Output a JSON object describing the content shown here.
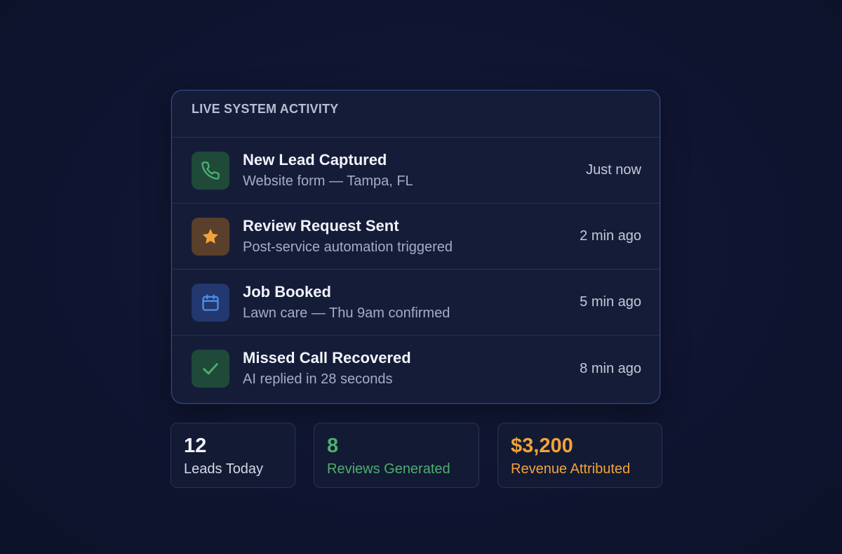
{
  "activity": {
    "title": "LIVE SYSTEM ACTIVITY",
    "items": [
      {
        "icon": "phone-icon",
        "title": "New Lead Captured",
        "subtitle": "Website form — Tampa, FL",
        "time": "Just now",
        "icon_color": "#4caf6e",
        "tile_color": "#1f4a3a"
      },
      {
        "icon": "star-icon",
        "title": "Review Request Sent",
        "subtitle": "Post-service automation triggered",
        "time": "2 min ago",
        "icon_color": "#f2a33a",
        "tile_color": "#5a3f2a"
      },
      {
        "icon": "calendar-icon",
        "title": "Job Booked",
        "subtitle": "Lawn care — Thu 9am confirmed",
        "time": "5 min ago",
        "icon_color": "#4d8ef0",
        "tile_color": "#22386e"
      },
      {
        "icon": "check-icon",
        "title": "Missed Call Recovered",
        "subtitle": "AI replied in 28 seconds",
        "time": "8 min ago",
        "icon_color": "#4caf6e",
        "tile_color": "#1f4a3a"
      }
    ]
  },
  "stats": [
    {
      "value": "12",
      "label": "Leads Today",
      "color": "#f1f3f9",
      "label_color": "#d5d9e5"
    },
    {
      "value": "8",
      "label": "Reviews Generated",
      "color": "#4caf6e",
      "label_color": "#4caf6e"
    },
    {
      "value": "$3,200",
      "label": "Revenue Attributed",
      "color": "#f2a33a",
      "label_color": "#f2a33a"
    }
  ],
  "colors": {
    "background": "#0f1530",
    "card": "#151c38",
    "card_border": "#3a4a8c",
    "divider": "#283258"
  }
}
